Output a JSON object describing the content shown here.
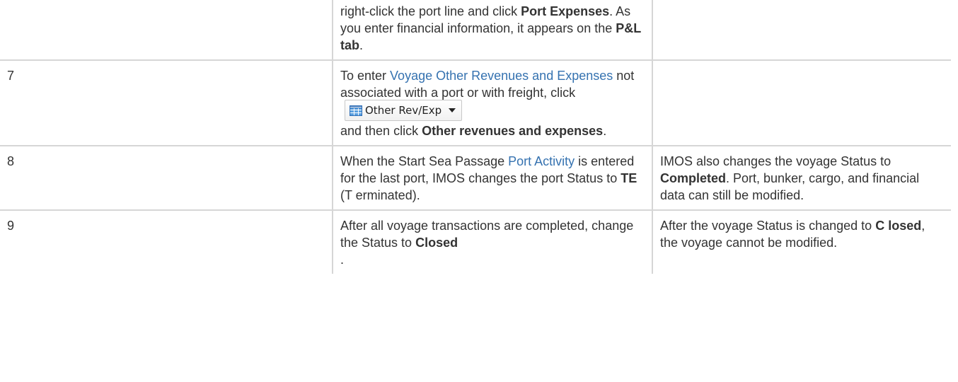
{
  "rows": [
    {
      "step": "",
      "action": {
        "t1": "right-click the port line and click ",
        "b1": "Port Expenses",
        "t2": ". As you enter financial information, it appears on the ",
        "b2": "P&L tab",
        "t3": "."
      },
      "note": ""
    },
    {
      "step": "7",
      "action": {
        "t1": "To enter ",
        "link": "Voyage Other Revenues and Expenses",
        "t2": " not associated with a port or with freight, click",
        "button_label": "Other Rev/Exp",
        "button_icon": "grid-icon",
        "t3": "and then click ",
        "b1": "Other revenues and expenses",
        "t4": "."
      },
      "note": ""
    },
    {
      "step": "8",
      "action": {
        "t1": "When the Start Sea Passage ",
        "link": "Port Activity",
        "t2": " is entered for the last port, IMOS changes the port Status to ",
        "b1": "TE",
        "t3": " (T erminated)."
      },
      "note": {
        "t1": "IMOS also changes the voyage Status to ",
        "b1": "Completed",
        "t2": ". Port, bunker, cargo, and financial data can still be modified."
      }
    },
    {
      "step": "9",
      "action": {
        "t1": "After all voyage transactions are completed, change the Status to ",
        "b1": "Closed",
        "t2": "."
      },
      "note": {
        "t1": "After the voyage Status is changed to ",
        "b1": "C losed",
        "t2": ", the voyage cannot be modified."
      }
    }
  ],
  "colors": {
    "text": "#333333",
    "link": "#3572b0",
    "border": "#d6d6d6"
  }
}
